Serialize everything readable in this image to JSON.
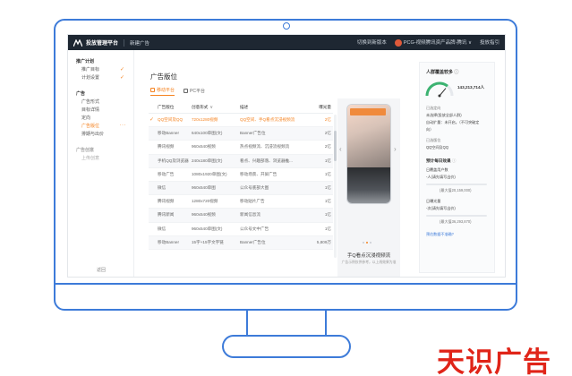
{
  "topbar": {
    "brand": "投放管理平台",
    "new_ad": "新建广告",
    "switch_account": "切换到新版本",
    "user": "PCG-视频腾讯资产品牌-腾讯 ∨",
    "help": "投放指引"
  },
  "sidebar": {
    "groups": [
      {
        "title": "推广计划",
        "items": [
          {
            "label": "推广目标",
            "checked": true
          },
          {
            "label": "计划设置",
            "checked": true
          }
        ]
      },
      {
        "title": "广告",
        "items": [
          {
            "label": "广告形式"
          },
          {
            "label": "目标详情"
          },
          {
            "label": "定向"
          },
          {
            "label": "广告版位",
            "active": true
          },
          {
            "label": "排期与出价"
          }
        ]
      },
      {
        "title": "广告创意",
        "items": [
          {
            "label": "上传创意"
          }
        ]
      }
    ],
    "footer": "返回"
  },
  "main": {
    "title": "广告版位",
    "tabs": [
      {
        "label": "移动平台",
        "active": true
      },
      {
        "label": "PC平台"
      }
    ],
    "table": {
      "headers": [
        "广告版位",
        "创意形式",
        "描述",
        "曝光量"
      ],
      "rows": [
        {
          "name": "QQ空间及QQ",
          "format": "720x1280视频",
          "desc": "QQ空间、手Q看点沉浸视频流",
          "reach": "2亿",
          "selected": true
        },
        {
          "name": "移动Banner",
          "format": "640x100单图(文)",
          "desc": "Banner广告位",
          "reach": "2亿"
        },
        {
          "name": "腾讯视频",
          "format": "960x540视频",
          "desc": "热点视频流、沉浸流视频流",
          "reach": "2亿"
        },
        {
          "name": "手机QQ及浏览器",
          "format": "240x180单图(文)",
          "desc": "看点、兴趣部落、浏览器推...",
          "reach": "1亿"
        },
        {
          "name": "移动广告",
          "format": "1080x1920单图(文)",
          "desc": "移动场景、开屏广告",
          "reach": "1亿"
        },
        {
          "name": "微信",
          "format": "960x540单图",
          "desc": "公众号底部大图",
          "reach": "1亿"
        },
        {
          "name": "腾讯视频",
          "format": "1280x720视频",
          "desc": "移动贴片广告",
          "reach": "1亿"
        },
        {
          "name": "腾讯新闻",
          "format": "960x540视频",
          "desc": "新闻信息流",
          "reach": "1亿"
        },
        {
          "name": "微信",
          "format": "960x540单图(文)",
          "desc": "公众号文中广告",
          "reach": "1亿"
        },
        {
          "name": "移动Banner",
          "format": "15字+15字文字链",
          "desc": "Banner广告位",
          "reach": "5,809万"
        }
      ]
    },
    "preview": {
      "title": "手Q看点沉浸视频流",
      "subtitle": "广告示例仅供参考，以上线效果为准"
    }
  },
  "right_panel": {
    "title": "人群覆盖较多",
    "gauge_value": "143,213,714人",
    "gauge_level": 0.72,
    "lines": [
      {
        "text": "已选定向",
        "style": "muted"
      },
      {
        "text": "未选择(投放全部人群)",
        "style": "dark"
      },
      {
        "text": "自动扩量：未开启。（不可突破定",
        "style": "dark"
      },
      {
        "text": "向）",
        "style": "dark"
      },
      {
        "text": "已选版位",
        "style": "muted"
      },
      {
        "text": "QQ空间及QQ",
        "style": "dark"
      }
    ],
    "forecast_title": "预计每日效果",
    "forecast": [
      {
        "label": "日覆盖用户数",
        "value": "-人(请先填写出价)",
        "max": "(最大值20,159,000)"
      },
      {
        "label": "日曝光量",
        "value": "-次(请先填写出价)",
        "max": "(最大值36,293,870)"
      }
    ],
    "link": "预估数据不准确?"
  },
  "watermark": "天识广告",
  "colors": {
    "accent": "#f5821f",
    "frame": "#3d7bd9",
    "topbar": "#1e2732",
    "watermark": "#e02418"
  }
}
